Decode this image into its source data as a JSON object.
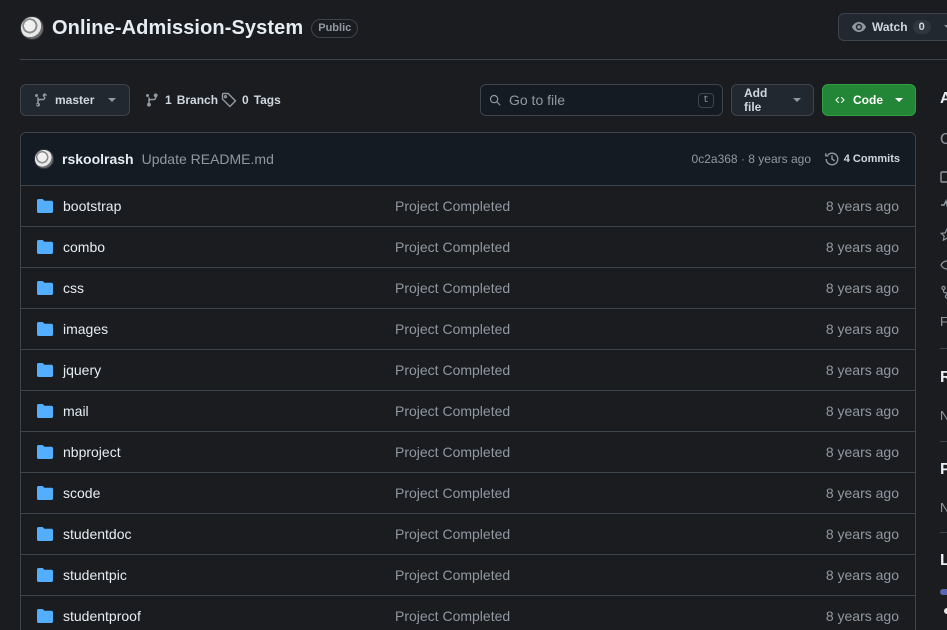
{
  "repo": {
    "name": "Online-Admission-System",
    "visibility": "Public",
    "watch_label": "Watch",
    "watch_count": "0"
  },
  "toolbar": {
    "branch_label": "master",
    "branches_count": "1",
    "branches_label": "Branch",
    "tags_count": "0",
    "tags_label": "Tags",
    "search_placeholder": "Go to file",
    "search_shortcut": "t",
    "add_file_label": "Add file",
    "code_label": "Code"
  },
  "latest_commit": {
    "author": "rskoolrash",
    "message": "Update README.md",
    "hash": "0c2a368",
    "separator": "·",
    "time": "8 years ago",
    "commits_label": "4 Commits"
  },
  "files": [
    {
      "name": "bootstrap",
      "message": "Project Completed",
      "date": "8 years ago"
    },
    {
      "name": "combo",
      "message": "Project Completed",
      "date": "8 years ago"
    },
    {
      "name": "css",
      "message": "Project Completed",
      "date": "8 years ago"
    },
    {
      "name": "images",
      "message": "Project Completed",
      "date": "8 years ago"
    },
    {
      "name": "jquery",
      "message": "Project Completed",
      "date": "8 years ago"
    },
    {
      "name": "mail",
      "message": "Project Completed",
      "date": "8 years ago"
    },
    {
      "name": "nbproject",
      "message": "Project Completed",
      "date": "8 years ago"
    },
    {
      "name": "scode",
      "message": "Project Completed",
      "date": "8 years ago"
    },
    {
      "name": "studentdoc",
      "message": "Project Completed",
      "date": "8 years ago"
    },
    {
      "name": "studentpic",
      "message": "Project Completed",
      "date": "8 years ago"
    },
    {
      "name": "studentproof",
      "message": "Project Completed",
      "date": "8 years ago"
    }
  ],
  "sidebar_fragments": {
    "about_initial": "A",
    "desc_initial": "O",
    "releases_initial": "R",
    "releases_text_initial": "N",
    "packages_initial": "P",
    "packages_text_initial": "N",
    "languages_initial": "L",
    "forks_initial": "F"
  },
  "colors": {
    "background": "#1a1c20",
    "code_button": "#238636",
    "folder_icon": "#54aeff",
    "language_bar_1": "#5865b4",
    "language_bar_2": "#e8e8e8"
  },
  "icons": {
    "branch": "git-branch-icon",
    "tag": "tag-icon",
    "search": "search-icon",
    "history": "history-icon",
    "folder": "folder-icon",
    "eye": "eye-icon",
    "code": "code-icon"
  }
}
